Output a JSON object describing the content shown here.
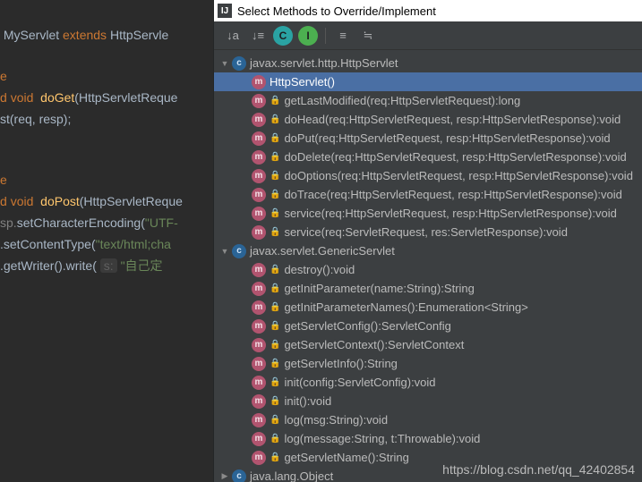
{
  "editor": {
    "l1a": "MyServlet ",
    "l1b": "extends",
    "l1c": " HttpServle",
    "l3": "e",
    "l4a": "d ",
    "l4b": "void",
    "l4c": " doGet",
    "l4d": "(HttpServletReque",
    "l5": "st(req, resp);",
    "l8": "e",
    "l9a": "d ",
    "l9b": "void",
    "l9c": " doPost",
    "l9d": "(HttpServletReque",
    "l10a": "sp.",
    "l10b": "setCharacterEncoding",
    "l10c": "(",
    "l10d": "\"UTF-",
    "l11a": ".",
    "l11b": "setContentType",
    "l11c": "(",
    "l11d": "\"text/html;cha",
    "l12a": ".",
    "l12b": "getWriter",
    "l12c": "().",
    "l12d": "write",
    "l12e": "(",
    "l12hint": "s:",
    "l12f": "\"自己定"
  },
  "dialog": {
    "title": "Select Methods to Override/Implement",
    "toolbar": {
      "sort_down": "↓a",
      "sort_up": "↓≡",
      "c": "C",
      "i": "I",
      "expand": "≡",
      "collapse": "≒"
    }
  },
  "tree": [
    {
      "depth": 0,
      "twisty": "▼",
      "icon": "class",
      "lock": false,
      "label": "javax.servlet.http.HttpServlet",
      "sel": false
    },
    {
      "depth": 1,
      "twisty": "",
      "icon": "method",
      "lock": false,
      "label": "HttpServlet()",
      "sel": true
    },
    {
      "depth": 1,
      "twisty": "",
      "icon": "method",
      "lock": true,
      "label": "getLastModified(req:HttpServletRequest):long",
      "sel": false
    },
    {
      "depth": 1,
      "twisty": "",
      "icon": "method",
      "lock": true,
      "label": "doHead(req:HttpServletRequest, resp:HttpServletResponse):void",
      "sel": false
    },
    {
      "depth": 1,
      "twisty": "",
      "icon": "method",
      "lock": true,
      "label": "doPut(req:HttpServletRequest, resp:HttpServletResponse):void",
      "sel": false
    },
    {
      "depth": 1,
      "twisty": "",
      "icon": "method",
      "lock": true,
      "label": "doDelete(req:HttpServletRequest, resp:HttpServletResponse):void",
      "sel": false
    },
    {
      "depth": 1,
      "twisty": "",
      "icon": "method",
      "lock": true,
      "label": "doOptions(req:HttpServletRequest, resp:HttpServletResponse):void",
      "sel": false
    },
    {
      "depth": 1,
      "twisty": "",
      "icon": "method",
      "lock": true,
      "label": "doTrace(req:HttpServletRequest, resp:HttpServletResponse):void",
      "sel": false
    },
    {
      "depth": 1,
      "twisty": "",
      "icon": "method",
      "lock": true,
      "label": "service(req:HttpServletRequest, resp:HttpServletResponse):void",
      "sel": false
    },
    {
      "depth": 1,
      "twisty": "",
      "icon": "method",
      "lock": true,
      "label": "service(req:ServletRequest, res:ServletResponse):void",
      "sel": false
    },
    {
      "depth": 0,
      "twisty": "▼",
      "icon": "class",
      "lock": false,
      "label": "javax.servlet.GenericServlet",
      "sel": false
    },
    {
      "depth": 1,
      "twisty": "",
      "icon": "method",
      "lock": true,
      "label": "destroy():void",
      "sel": false
    },
    {
      "depth": 1,
      "twisty": "",
      "icon": "method",
      "lock": true,
      "label": "getInitParameter(name:String):String",
      "sel": false
    },
    {
      "depth": 1,
      "twisty": "",
      "icon": "method",
      "lock": true,
      "label": "getInitParameterNames():Enumeration<String>",
      "sel": false
    },
    {
      "depth": 1,
      "twisty": "",
      "icon": "method",
      "lock": true,
      "label": "getServletConfig():ServletConfig",
      "sel": false
    },
    {
      "depth": 1,
      "twisty": "",
      "icon": "method",
      "lock": true,
      "label": "getServletContext():ServletContext",
      "sel": false
    },
    {
      "depth": 1,
      "twisty": "",
      "icon": "method",
      "lock": true,
      "label": "getServletInfo():String",
      "sel": false
    },
    {
      "depth": 1,
      "twisty": "",
      "icon": "method",
      "lock": true,
      "label": "init(config:ServletConfig):void",
      "sel": false
    },
    {
      "depth": 1,
      "twisty": "",
      "icon": "method",
      "lock": true,
      "label": "init():void",
      "sel": false
    },
    {
      "depth": 1,
      "twisty": "",
      "icon": "method",
      "lock": true,
      "label": "log(msg:String):void",
      "sel": false
    },
    {
      "depth": 1,
      "twisty": "",
      "icon": "method",
      "lock": true,
      "label": "log(message:String, t:Throwable):void",
      "sel": false
    },
    {
      "depth": 1,
      "twisty": "",
      "icon": "method",
      "lock": true,
      "label": "getServletName():String",
      "sel": false
    },
    {
      "depth": 0,
      "twisty": "▶",
      "icon": "class",
      "lock": false,
      "label": "java.lang.Object",
      "sel": false
    }
  ],
  "watermark": "https://blog.csdn.net/qq_42402854"
}
